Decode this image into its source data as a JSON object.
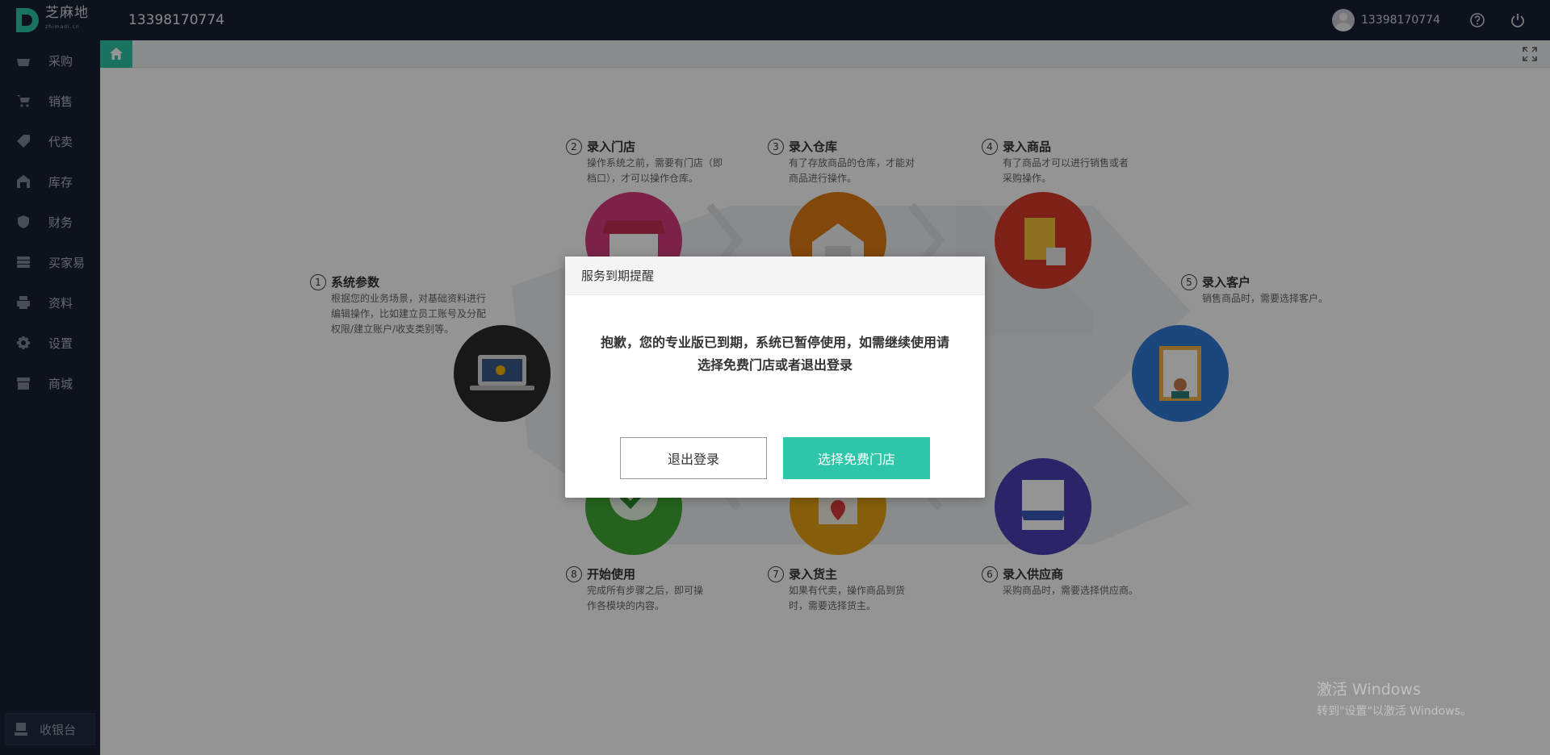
{
  "topbar": {
    "logo_text": "芝麻地",
    "logo_sub": "zhimadi.cn",
    "account_title": "13398170774",
    "user_phone": "13398170774"
  },
  "sidebar": {
    "items": [
      {
        "label": "采购",
        "icon": "basket-icon"
      },
      {
        "label": "销售",
        "icon": "cart-icon"
      },
      {
        "label": "代卖",
        "icon": "tag-icon"
      },
      {
        "label": "库存",
        "icon": "warehouse-icon"
      },
      {
        "label": "财务",
        "icon": "finance-icon"
      },
      {
        "label": "买家易",
        "icon": "stack-icon"
      },
      {
        "label": "资料",
        "icon": "printer-icon"
      },
      {
        "label": "设置",
        "icon": "gear-icon"
      },
      {
        "label": "商城",
        "icon": "store-icon"
      }
    ],
    "cashier_label": "收银台"
  },
  "guide": {
    "steps": [
      {
        "num": "1",
        "title": "系统参数",
        "desc": [
          "根据您的业务场景，对基础资料进行",
          "编辑操作，比如建立员工账号及分配",
          "权限/建立账户/收支类别等。"
        ],
        "color": "#2a2a2a"
      },
      {
        "num": "2",
        "title": "录入门店",
        "desc": [
          "操作系统之前，需要有门店（即",
          "档口），才可以操作仓库。"
        ],
        "color": "#d63c7f"
      },
      {
        "num": "3",
        "title": "录入仓库",
        "desc": [
          "有了存放商品的仓库，才能对",
          "商品进行操作。"
        ],
        "color": "#e07a12"
      },
      {
        "num": "4",
        "title": "录入商品",
        "desc": [
          "有了商品才可以进行销售或者",
          "采购操作。"
        ],
        "color": "#d73a2a"
      },
      {
        "num": "5",
        "title": "录入客户",
        "desc": [
          "销售商品时，需要选择客户。"
        ],
        "color": "#2f7bd6"
      },
      {
        "num": "6",
        "title": "录入供应商",
        "desc": [
          "采购商品时，需要选择供应商。"
        ],
        "color": "#4b3fb4"
      },
      {
        "num": "7",
        "title": "录入货主",
        "desc": [
          "如果有代卖，操作商品到货",
          "时，需要选择货主。"
        ],
        "color": "#e7a214"
      },
      {
        "num": "8",
        "title": "开始使用",
        "desc": [
          "完成所有步骤之后，即可操",
          "作各模块的内容。"
        ],
        "color": "#3eaa33"
      }
    ]
  },
  "modal": {
    "title": "服务到期提醒",
    "message_line1": "抱歉，您的专业版已到期，系统已暂停使用，如需继续使用请",
    "message_line2": "选择免费门店或者退出登录",
    "logout_label": "退出登录",
    "choose_label": "选择免费门店",
    "accent_color": "#2dc6a8"
  },
  "watermark": {
    "line1": "激活 Windows",
    "line2": "转到\"设置\"以激活 Windows。"
  }
}
